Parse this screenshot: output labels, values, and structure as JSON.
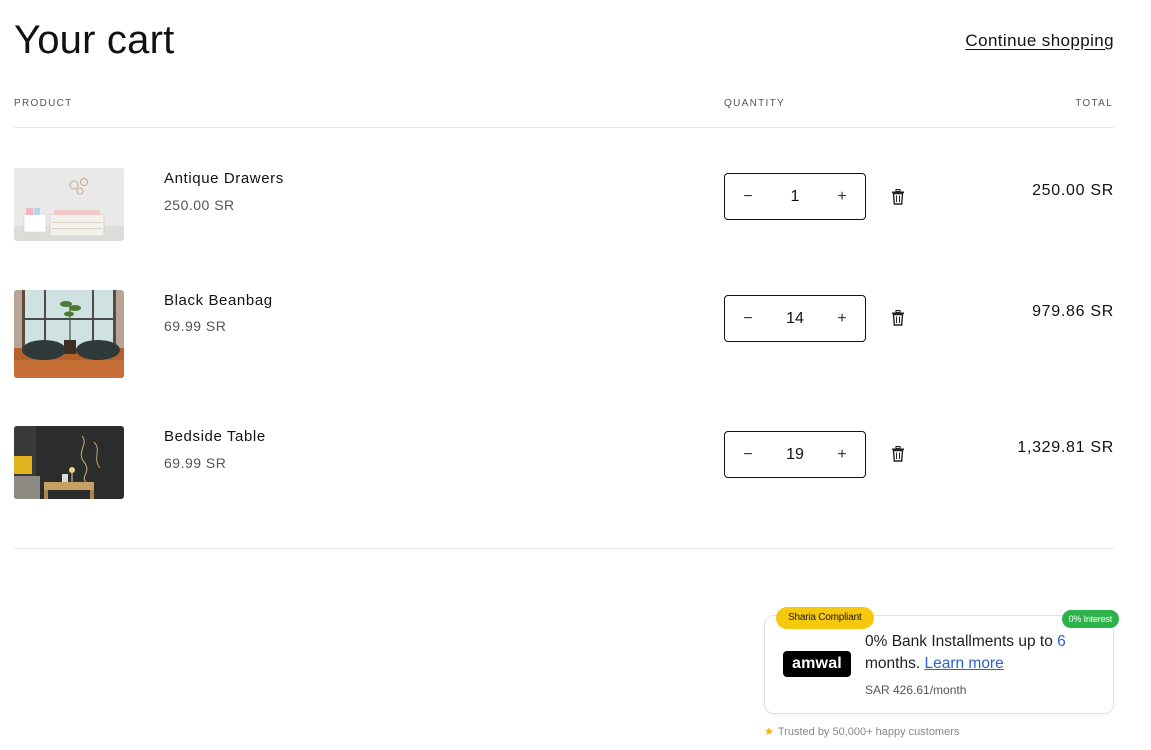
{
  "header": {
    "title": "Your cart",
    "continue_label": "Continue shopping"
  },
  "columns": {
    "product": "PRODUCT",
    "quantity": "QUANTITY",
    "total": "TOTAL"
  },
  "items": [
    {
      "name": "Antique Drawers",
      "price": "250.00 SR",
      "quantity": "1",
      "total": "250.00 SR"
    },
    {
      "name": "Black Beanbag",
      "price": "69.99 SR",
      "quantity": "14",
      "total": "979.86 SR"
    },
    {
      "name": "Bedside Table",
      "price": "69.99 SR",
      "quantity": "19",
      "total": "1,329.81 SR"
    }
  ],
  "qty_controls": {
    "minus": "−",
    "plus": "+"
  },
  "amwal": {
    "badge_sharia": "Sharia Compliant",
    "badge_interest": "0% Interest",
    "logo_text": "amwal",
    "headline_prefix": "0% Bank Installments up to ",
    "headline_months": "6",
    "headline_suffix": " months.",
    "learn_more": "Learn more",
    "monthly": "SAR 426.61/month",
    "trusted": "Trusted by 50,000+ happy customers"
  },
  "icons": {
    "trash": "trash-icon",
    "star": "star-icon"
  }
}
